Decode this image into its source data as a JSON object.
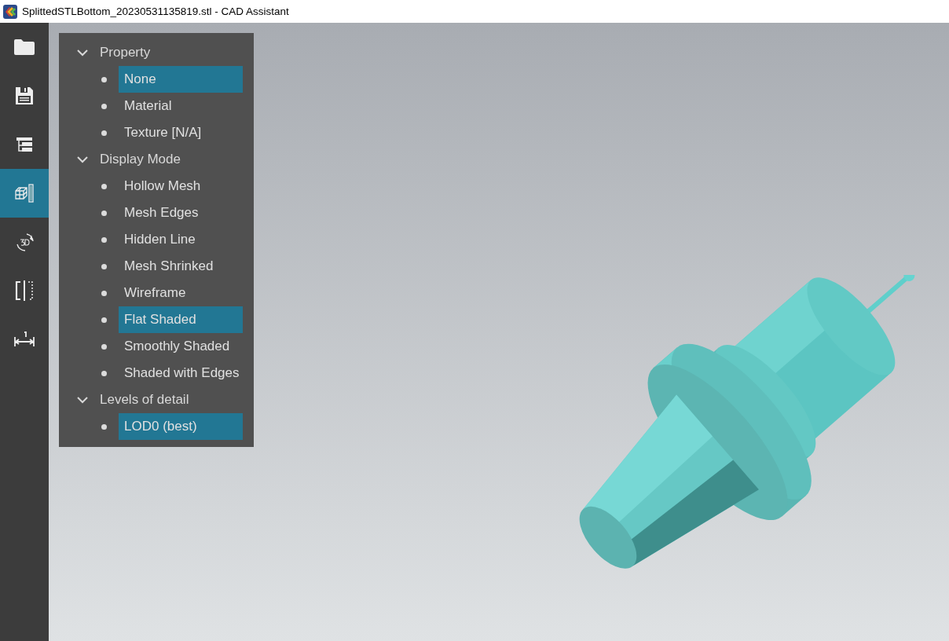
{
  "window": {
    "title": "SplittedSTLBottom_20230531135819.stl - CAD Assistant"
  },
  "toolbar": [
    {
      "kind": "folder",
      "selected": false
    },
    {
      "kind": "save",
      "selected": false
    },
    {
      "kind": "tree",
      "selected": false
    },
    {
      "kind": "display",
      "selected": true
    },
    {
      "kind": "rotate3d",
      "selected": false
    },
    {
      "kind": "section",
      "selected": false
    },
    {
      "kind": "measure",
      "selected": false
    }
  ],
  "panel": {
    "groups": [
      {
        "label": "Property",
        "expanded": true,
        "items": [
          {
            "label": "None",
            "selected": true
          },
          {
            "label": "Material",
            "selected": false
          },
          {
            "label": "Texture [N/A]",
            "selected": false
          }
        ]
      },
      {
        "label": "Display Mode",
        "expanded": true,
        "items": [
          {
            "label": "Hollow Mesh",
            "selected": false
          },
          {
            "label": "Mesh Edges",
            "selected": false
          },
          {
            "label": "Hidden Line",
            "selected": false
          },
          {
            "label": "Mesh Shrinked",
            "selected": false
          },
          {
            "label": "Wireframe",
            "selected": false
          },
          {
            "label": "Flat Shaded",
            "selected": true
          },
          {
            "label": "Smoothly Shaded",
            "selected": false
          },
          {
            "label": "Shaded with Edges",
            "selected": false
          }
        ]
      },
      {
        "label": "Levels of detail",
        "expanded": true,
        "items": [
          {
            "label": "LOD0 (best)",
            "selected": true
          }
        ]
      }
    ]
  }
}
